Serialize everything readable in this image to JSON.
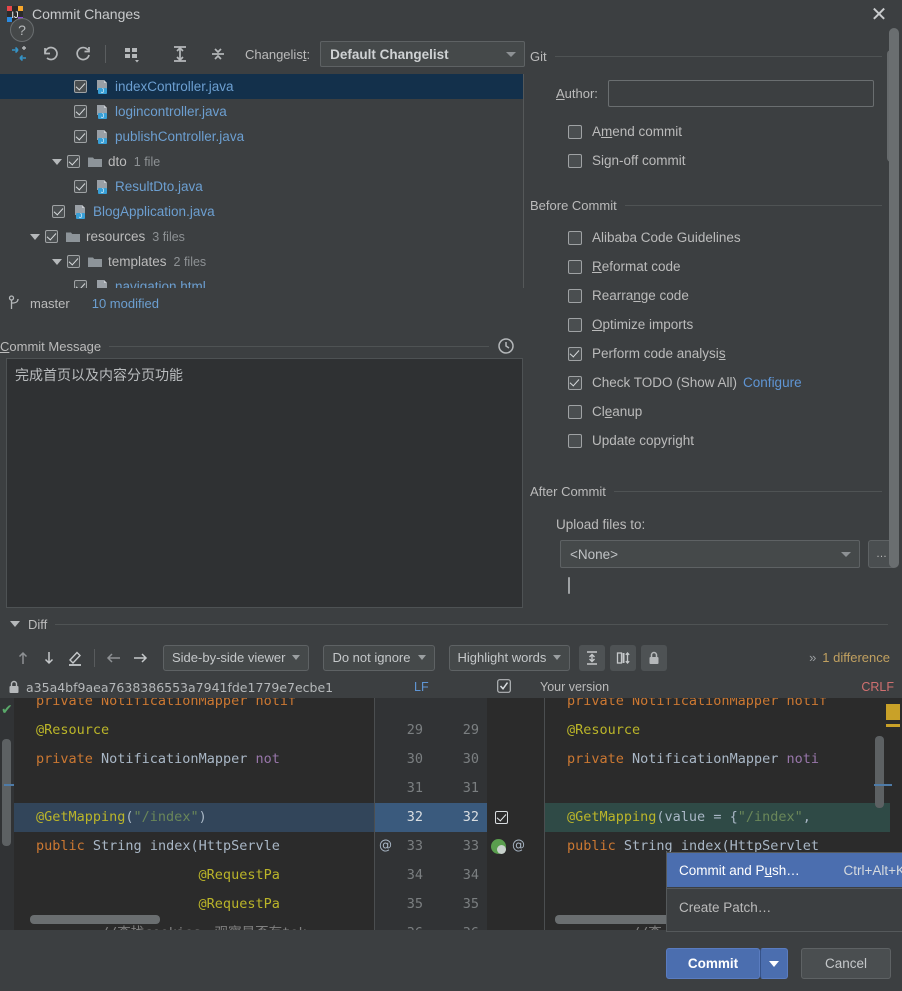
{
  "window": {
    "title": "Commit Changes",
    "app_icon": "intellij-idea-icon",
    "close_label": "✕"
  },
  "toolbar": {
    "icons": [
      {
        "name": "collapse-to-changes-icon",
        "glyph": "⤵"
      },
      {
        "name": "rollback-icon",
        "glyph": "↶"
      },
      {
        "name": "refresh-icon",
        "glyph": "↻"
      },
      {
        "name": "group-by-icon",
        "glyph": "▦"
      },
      {
        "name": "expand-all-icon",
        "glyph": "↧"
      },
      {
        "name": "collapse-all-icon",
        "glyph": "↥"
      }
    ],
    "changelist_label": "Changelist:",
    "changelist_value": "Default Changelist"
  },
  "tree": {
    "rows": [
      {
        "indent": 4,
        "twisty": false,
        "checked": true,
        "icon": "java-file-icon",
        "name": "indexController.java",
        "count": "",
        "selected": true,
        "plain": false
      },
      {
        "indent": 4,
        "twisty": false,
        "checked": true,
        "icon": "java-file-icon",
        "name": "logincontroller.java",
        "count": "",
        "selected": false,
        "plain": false
      },
      {
        "indent": 4,
        "twisty": false,
        "checked": true,
        "icon": "java-file-icon",
        "name": "publishController.java",
        "count": "",
        "selected": false,
        "plain": false
      },
      {
        "indent": 3,
        "twisty": true,
        "checked": true,
        "icon": "folder-icon",
        "name": "dto",
        "count": "1 file",
        "selected": false,
        "plain": true
      },
      {
        "indent": 4,
        "twisty": false,
        "checked": true,
        "icon": "java-file-icon",
        "name": "ResultDto.java",
        "count": "",
        "selected": false,
        "plain": false
      },
      {
        "indent": 3,
        "twisty": false,
        "checked": true,
        "icon": "java-file-icon",
        "name": "BlogApplication.java",
        "count": "",
        "selected": false,
        "plain": false
      },
      {
        "indent": 2,
        "twisty": true,
        "checked": true,
        "icon": "folder-icon",
        "name": "resources",
        "count": "3 files",
        "selected": false,
        "plain": true
      },
      {
        "indent": 3,
        "twisty": true,
        "checked": true,
        "icon": "folder-icon",
        "name": "templates",
        "count": "2 files",
        "selected": false,
        "plain": true
      },
      {
        "indent": 4,
        "twisty": false,
        "checked": true,
        "icon": "html-file-icon",
        "name": "navigation.html",
        "count": "",
        "selected": false,
        "plain": false
      }
    ]
  },
  "branch_bar": {
    "icon": "git-branch-icon",
    "branch": "master",
    "modified": "10 modified"
  },
  "commit_message": {
    "label_prefix": "C",
    "label_rest": "ommit Message",
    "history_icon": "clock-history-icon",
    "value": "完成首页以及内容分页功能"
  },
  "git_group": {
    "title": "Git",
    "author_label_prefix": "A",
    "author_label_rest": "uthor:",
    "author_value": "",
    "options": [
      {
        "label_pre": "A",
        "label_accel": "m",
        "label_post": "end commit",
        "checked": false,
        "name": "amend-commit"
      },
      {
        "label_pre": "Si",
        "label_accel": "g",
        "label_post": "n-off commit",
        "checked": false,
        "name": "sign-off-commit"
      }
    ]
  },
  "before_commit": {
    "title": "Before Commit",
    "options": [
      {
        "label_pre": "",
        "label_accel": "",
        "label_post": "Alibaba Code Guidelines",
        "checked": false,
        "name": "alibaba-code-guidelines"
      },
      {
        "label_pre": "",
        "label_accel": "R",
        "label_post": "eformat code",
        "checked": false,
        "name": "reformat-code"
      },
      {
        "label_pre": "Rearra",
        "label_accel": "n",
        "label_post": "ge code",
        "checked": false,
        "name": "rearrange-code"
      },
      {
        "label_pre": "",
        "label_accel": "O",
        "label_post": "ptimize imports",
        "checked": false,
        "name": "optimize-imports"
      },
      {
        "label_pre": "Perform code analysi",
        "label_accel": "s",
        "label_post": "",
        "checked": true,
        "name": "perform-code-analysis"
      },
      {
        "label_pre": "Check TODO (Show All)",
        "label_accel": "",
        "label_post": "",
        "checked": true,
        "name": "check-todo",
        "link": "Configure"
      },
      {
        "label_pre": "Cl",
        "label_accel": "e",
        "label_post": "anup",
        "checked": false,
        "name": "cleanup"
      },
      {
        "label_pre": "",
        "label_accel": "",
        "label_post": "Update copyright",
        "checked": false,
        "name": "update-copyright"
      }
    ]
  },
  "after_commit": {
    "title": "After Commit",
    "upload_label": "Upload files to:",
    "upload_value": "<None>",
    "browse_label": "…"
  },
  "diff": {
    "section_label": "Diff",
    "nav_icons": [
      {
        "name": "previous-difference-icon",
        "glyph": "↑"
      },
      {
        "name": "next-difference-icon",
        "glyph": "↓"
      },
      {
        "name": "edit-source-icon",
        "glyph": "✎"
      },
      {
        "name": "accept-left-icon",
        "glyph": "←"
      },
      {
        "name": "accept-right-icon",
        "glyph": "→"
      }
    ],
    "viewer_mode": "Side-by-side viewer",
    "ignore_mode": "Do not ignore",
    "highlight_mode": "Highlight words",
    "toggle_icons": [
      {
        "name": "collapse-unchanged-icon",
        "glyph": "↥"
      },
      {
        "name": "synchronize-scroll-icon",
        "glyph": "↕"
      },
      {
        "name": "read-only-lock-icon",
        "glyph": "ὑ2"
      }
    ],
    "difference_count": "1 difference",
    "expand_chevron": "»",
    "left_revision": "a35a4bf9aea7638386553a7941fde1779e7ecbe1",
    "left_lock_icon": "lock-icon",
    "left_line_ending": "LF",
    "right_title": "Your version",
    "right_line_ending": "CRLF",
    "right_checkbox_checked": true
  },
  "code": {
    "left_lines": [
      {
        "num": "",
        "parts": [
          {
            "t": "private NotificationMapper notif",
            "c": "tok-kw"
          }
        ],
        "truncated": true,
        "partial": true
      },
      {
        "num": "29",
        "parts": [
          {
            "t": "@Resource",
            "c": "tok-ann"
          }
        ]
      },
      {
        "num": "30",
        "parts": [
          {
            "t": "private ",
            "c": "tok-kw"
          },
          {
            "t": "NotificationMapper ",
            "c": "tok-id"
          },
          {
            "t": "not",
            "c": "tok-fld"
          }
        ]
      },
      {
        "num": "31",
        "parts": []
      },
      {
        "num": "32",
        "parts": [
          {
            "t": "@GetMapping",
            "c": "tok-ann"
          },
          {
            "t": "(",
            "c": "tok-par"
          },
          {
            "t": "\"/index\"",
            "c": "tok-str"
          },
          {
            "t": ")",
            "c": "tok-par"
          }
        ],
        "highlight": true
      },
      {
        "num": "33",
        "parts": [
          {
            "t": "public ",
            "c": "tok-kw"
          },
          {
            "t": "String ",
            "c": "tok-cls"
          },
          {
            "t": "index",
            "c": "tok-id"
          },
          {
            "t": "(",
            "c": "tok-par"
          },
          {
            "t": "HttpServle",
            "c": "tok-cls"
          }
        ]
      },
      {
        "num": "34",
        "parts": [
          {
            "t": "                    @RequestPa",
            "c": "tok-ann"
          }
        ]
      },
      {
        "num": "35",
        "parts": [
          {
            "t": "                    @RequestPa",
            "c": "tok-ann"
          }
        ]
      },
      {
        "num": "36",
        "parts": [
          {
            "t": "        //查找cookies，观察是否有tok",
            "c": "tok-cmt"
          }
        ]
      }
    ],
    "right_lines": [
      {
        "num": "",
        "parts": [
          {
            "t": "private NotificationMapper notif",
            "c": "tok-kw"
          }
        ],
        "partial": true
      },
      {
        "num": "29",
        "parts": [
          {
            "t": "@Resource",
            "c": "tok-ann"
          }
        ]
      },
      {
        "num": "30",
        "parts": [
          {
            "t": "private ",
            "c": "tok-kw"
          },
          {
            "t": "NotificationMapper ",
            "c": "tok-id"
          },
          {
            "t": "noti",
            "c": "tok-fld"
          }
        ]
      },
      {
        "num": "31",
        "parts": []
      },
      {
        "num": "32",
        "parts": [
          {
            "t": "@GetMapping",
            "c": "tok-ann"
          },
          {
            "t": "(",
            "c": "tok-par"
          },
          {
            "t": "value ",
            "c": "tok-id"
          },
          {
            "t": "= ",
            "c": "tok-par"
          },
          {
            "t": "{",
            "c": "tok-par"
          },
          {
            "t": "\"/index\"",
            "c": "tok-str"
          },
          {
            "t": ",",
            "c": "tok-par"
          }
        ],
        "highlight": true
      },
      {
        "num": "33",
        "parts": [
          {
            "t": "public ",
            "c": "tok-kw"
          },
          {
            "t": "String ",
            "c": "tok-cls"
          },
          {
            "t": "index",
            "c": "tok-id"
          },
          {
            "t": "(",
            "c": "tok-par"
          },
          {
            "t": "HttpServlet",
            "c": "tok-cls"
          }
        ]
      },
      {
        "num": "34",
        "parts": []
      },
      {
        "num": "35",
        "parts": []
      },
      {
        "num": "36",
        "parts": [
          {
            "t": "        //查",
            "c": "tok-cmt"
          }
        ]
      }
    ],
    "left_gutter_marks": [
      {
        "line": 33,
        "mark": "@"
      }
    ],
    "right_gutter_marks": [
      {
        "line": 32,
        "mark": "checkbox"
      },
      {
        "line": 33,
        "mark": "green-bean-at"
      }
    ]
  },
  "context_menu": {
    "items": [
      {
        "label_pre": "Commit and P",
        "accel": "u",
        "label_post": "sh…",
        "shortcut": "Ctrl+Alt+K",
        "selected": true,
        "name": "commit-and-push"
      },
      {
        "label_pre": "Create Patch…",
        "accel": "",
        "label_post": "",
        "shortcut": "",
        "selected": false,
        "name": "create-patch"
      }
    ]
  },
  "bottom_bar": {
    "help_label": "?",
    "commit_label": "Commit",
    "cancel_label": "Cancel"
  },
  "colors": {
    "accent_blue": "#4b6eaf",
    "link_blue": "#5f95d4",
    "selection_row": "#13304b",
    "panel_bg": "#3c3f41",
    "editor_bg": "#2b2b2b",
    "diff_count_orange": "#c0a060",
    "crlf_red": "#d07070"
  }
}
